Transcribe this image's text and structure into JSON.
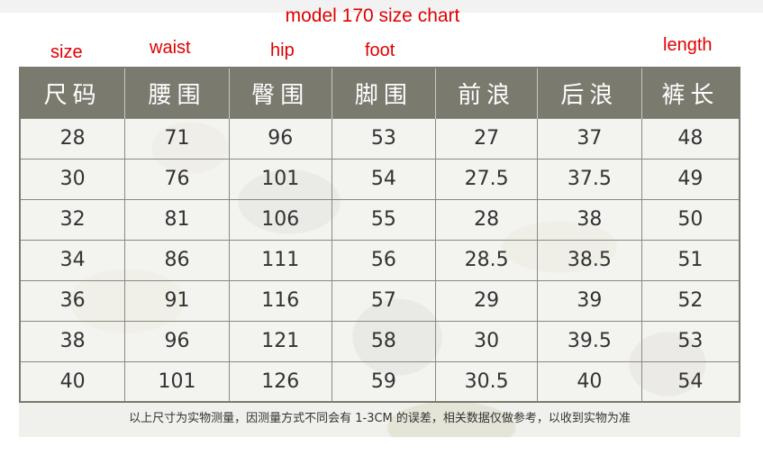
{
  "title": "model 170 size chart",
  "english_labels": {
    "size": "size",
    "waist": "waist",
    "hip": "hip",
    "foot": "foot",
    "length": "length"
  },
  "headers": [
    "尺码",
    "腰围",
    "臀围",
    "脚围",
    "前浪",
    "后浪",
    "裤长"
  ],
  "rows": [
    [
      "28",
      "71",
      "96",
      "53",
      "27",
      "37",
      "48"
    ],
    [
      "30",
      "76",
      "101",
      "54",
      "27.5",
      "37.5",
      "49"
    ],
    [
      "32",
      "81",
      "106",
      "55",
      "28",
      "38",
      "50"
    ],
    [
      "34",
      "86",
      "111",
      "56",
      "28.5",
      "38.5",
      "51"
    ],
    [
      "36",
      "91",
      "116",
      "57",
      "29",
      "39",
      "52"
    ],
    [
      "38",
      "96",
      "121",
      "58",
      "30",
      "39.5",
      "53"
    ],
    [
      "40",
      "101",
      "126",
      "59",
      "30.5",
      "40",
      "54"
    ]
  ],
  "note": "以上尺寸为实物测量，因测量方式不同会有 1-3CM 的误差，相关数据仅做参考，以收到实物为准",
  "colors": {
    "header_bg": "#7b7a6f",
    "annotation": "#e00000"
  }
}
